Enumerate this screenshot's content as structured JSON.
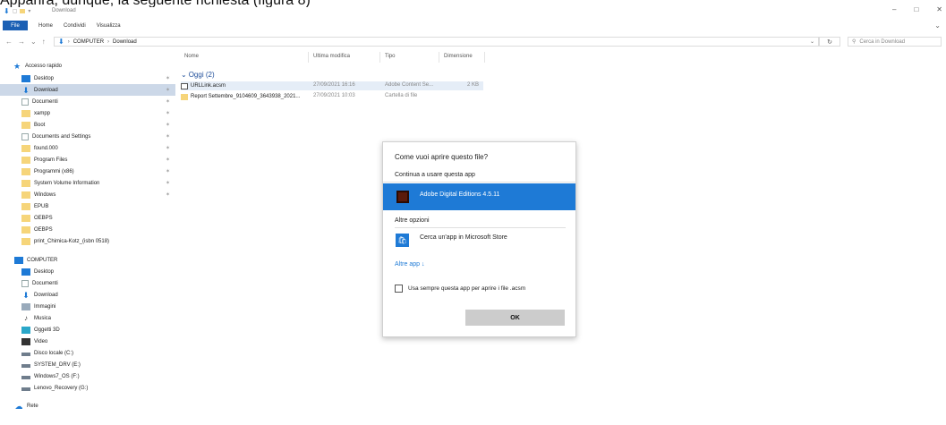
{
  "caption": "Apparirà, dunque, la seguente richiesta (figura 8)",
  "window": {
    "title": "Download",
    "controls": [
      "–",
      "□",
      "✕"
    ]
  },
  "ribbon": {
    "tabs": [
      "File",
      "Home",
      "Condividi",
      "Visualizza"
    ],
    "help": "⌄"
  },
  "address": {
    "path": [
      "COMPUTER",
      "Download"
    ],
    "search_placeholder": "Cerca in Download"
  },
  "sidebar": {
    "items": [
      {
        "label": "Accesso rapido",
        "icon": "star-icon",
        "pinned": false
      },
      {
        "label": "Desktop",
        "icon": "desktop-icon",
        "pinned": true
      },
      {
        "label": "Download",
        "icon": "download-icon",
        "pinned": true,
        "selected": true
      },
      {
        "label": "Documenti",
        "icon": "document-icon",
        "pinned": true
      },
      {
        "label": "xampp",
        "icon": "folder-icon",
        "pinned": true
      },
      {
        "label": "Boot",
        "icon": "folder-icon",
        "pinned": true
      },
      {
        "label": "Documents and Settings",
        "icon": "shortcut-icon",
        "pinned": true
      },
      {
        "label": "found.000",
        "icon": "folder-icon",
        "pinned": true
      },
      {
        "label": "Program Files",
        "icon": "folder-icon",
        "pinned": true
      },
      {
        "label": "Programmi (x86)",
        "icon": "folder-icon",
        "pinned": true
      },
      {
        "label": "System Volume Information",
        "icon": "folder-icon",
        "pinned": true
      },
      {
        "label": "Windows",
        "icon": "folder-icon",
        "pinned": true
      },
      {
        "label": "EPUB",
        "icon": "folder-icon",
        "pinned": false
      },
      {
        "label": "OEBPS",
        "icon": "folder-icon",
        "pinned": false
      },
      {
        "label": "OEBPS",
        "icon": "folder-icon",
        "pinned": false
      },
      {
        "label": "print_Chimica-Kotz_(isbn 0518)",
        "icon": "folder-icon",
        "pinned": false
      },
      {
        "label": "COMPUTER",
        "icon": "computer-icon",
        "pinned": false
      },
      {
        "label": "Desktop",
        "icon": "desktop-icon",
        "pinned": false
      },
      {
        "label": "Documenti",
        "icon": "document-icon",
        "pinned": false
      },
      {
        "label": "Download",
        "icon": "download-icon",
        "pinned": false
      },
      {
        "label": "Immagini",
        "icon": "pictures-icon",
        "pinned": false
      },
      {
        "label": "Musica",
        "icon": "music-icon",
        "pinned": false
      },
      {
        "label": "Oggetti 3D",
        "icon": "objects-3d-icon",
        "pinned": false
      },
      {
        "label": "Video",
        "icon": "video-icon",
        "pinned": false
      },
      {
        "label": "Disco locale (C:)",
        "icon": "drive-icon",
        "pinned": false
      },
      {
        "label": "SYSTEM_DRV (E:)",
        "icon": "drive-icon",
        "pinned": false
      },
      {
        "label": "Windows7_OS (F:)",
        "icon": "drive-icon",
        "pinned": false
      },
      {
        "label": "Lenovo_Recovery (G:)",
        "icon": "drive-icon",
        "pinned": false
      },
      {
        "label": "Rete",
        "icon": "network-icon",
        "pinned": false
      }
    ]
  },
  "filelist": {
    "columns": [
      "Nome",
      "Ultima modifica",
      "Tipo",
      "Dimensione"
    ],
    "group": "Oggi (2)",
    "rows": [
      {
        "name": "URLLink.acsm",
        "modified": "27/09/2021 16:16",
        "type": "Adobe Content Se...",
        "size": "2 KB"
      },
      {
        "name": "Report Settembre_9104609_3643938_2021...",
        "modified": "27/09/2021 10:03",
        "type": "Cartella di file",
        "size": ""
      }
    ]
  },
  "dialog": {
    "title": "Come vuoi aprire questo file?",
    "continue_label": "Continua a usare questa app",
    "selected_app": "Adobe Digital Editions 4.5.11",
    "other_options": "Altre opzioni",
    "store_option": "Cerca un'app in Microsoft Store",
    "more_apps": "Altre app ↓",
    "always_use": "Usa sempre questa app per aprire i file .acsm",
    "always_use_checked": false,
    "ok": "OK"
  }
}
